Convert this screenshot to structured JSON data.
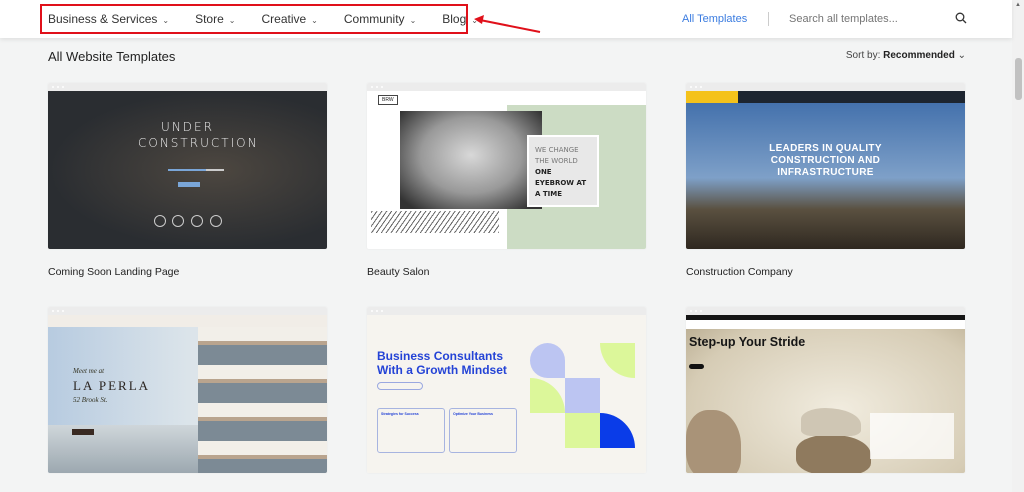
{
  "header": {
    "nav": [
      {
        "label": "Business & Services"
      },
      {
        "label": "Store"
      },
      {
        "label": "Creative"
      },
      {
        "label": "Community"
      },
      {
        "label": "Blog"
      }
    ],
    "all_templates": "All Templates",
    "search_placeholder": "Search all templates...",
    "highlight_color": "#e0101a",
    "link_color": "#3b7ce0"
  },
  "main": {
    "title": "All Website Templates",
    "sort_label": "Sort by:",
    "sort_value": "Recommended",
    "templates": [
      {
        "name": "Coming Soon Landing Page",
        "headline": "UNDER CONSTRUCTION"
      },
      {
        "name": "Beauty Salon",
        "headline_light": "WE CHANGE THE WORLD",
        "headline_bold": "ONE EYEBROW AT A TIME",
        "logo": "BRW"
      },
      {
        "name": "Construction Company",
        "headline": "LEADERS IN QUALITY CONSTRUCTION AND INFRASTRUCTURE"
      },
      {
        "name": "",
        "kicker": "Meet me at",
        "headline": "LA PERLA",
        "sub": "52 Brook St."
      },
      {
        "name": "",
        "headline": "Business Consultants With a Growth Mindset",
        "box1": "Strategies for Success",
        "box2": "Optimize Your Business"
      },
      {
        "name": "",
        "headline": "Step-up Your Stride"
      }
    ]
  }
}
